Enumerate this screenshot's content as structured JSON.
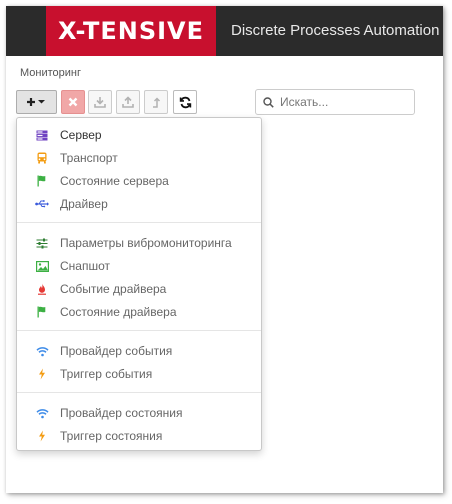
{
  "header": {
    "logo_text": "X-TENSIVE",
    "app_title": "Discrete Processes Automation"
  },
  "breadcrumb": "Мониторинг",
  "toolbar": {
    "add_icon": "plus-dropdown-icon",
    "delete_icon": "close-icon",
    "download_icon": "download-icon",
    "upload_icon": "upload-icon",
    "up_icon": "level-up-icon",
    "refresh_icon": "refresh-icon"
  },
  "search": {
    "placeholder": "Искать...",
    "value": ""
  },
  "menu": {
    "groups": [
      {
        "items": [
          {
            "label": "Сервер",
            "icon": "server-icon",
            "color": "#6f42c1"
          },
          {
            "label": "Транспорт",
            "icon": "bus-icon",
            "color": "#f39c12"
          },
          {
            "label": "Состояние сервера",
            "icon": "flag-icon",
            "color": "#3cb043"
          },
          {
            "label": "Драйвер",
            "icon": "usb-icon",
            "color": "#3b5bdb"
          }
        ]
      },
      {
        "items": [
          {
            "label": "Параметры вибромониторинга",
            "icon": "sliders-icon",
            "color": "#2e7d32"
          },
          {
            "label": "Снапшот",
            "icon": "image-icon",
            "color": "#3cb043"
          },
          {
            "label": "Событие драйвера",
            "icon": "fire-icon",
            "color": "#e53935"
          },
          {
            "label": "Состояние драйвера",
            "icon": "flag-icon",
            "color": "#3cb043"
          }
        ]
      },
      {
        "items": [
          {
            "label": "Провайдер события",
            "icon": "wifi-icon",
            "color": "#3d8be8"
          },
          {
            "label": "Триггер события",
            "icon": "bolt-icon",
            "color": "#f39c12"
          }
        ]
      },
      {
        "items": [
          {
            "label": "Провайдер состояния",
            "icon": "wifi-icon",
            "color": "#3d8be8"
          },
          {
            "label": "Триггер состояния",
            "icon": "bolt-icon",
            "color": "#f39c12"
          }
        ]
      }
    ]
  }
}
